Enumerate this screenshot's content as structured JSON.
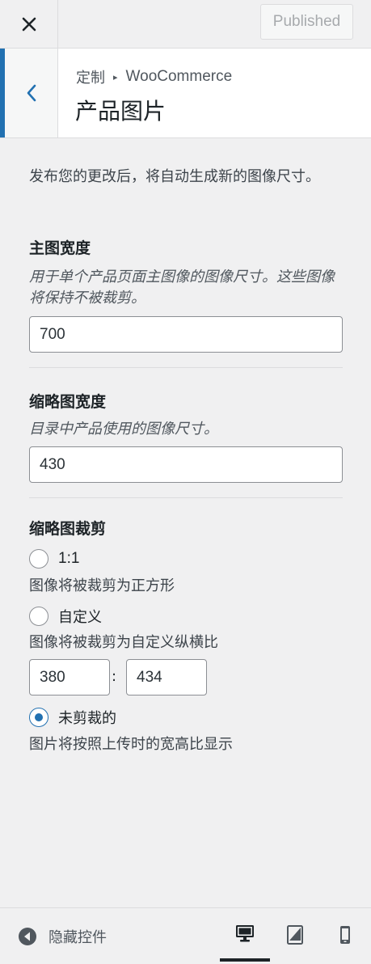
{
  "topbar": {
    "close_icon": "close-icon",
    "publish_label": "Published"
  },
  "header": {
    "back_icon": "chevron-left-icon",
    "breadcrumb_root": "定制",
    "breadcrumb_sep": "▸",
    "breadcrumb_section": "WooCommerce",
    "title": "产品图片"
  },
  "intro": "发布您的更改后，将自动生成新的图像尺寸。",
  "main_width": {
    "title": "主图宽度",
    "description": "用于单个产品页面主图像的图像尺寸。这些图像将保持不被裁剪。",
    "value": "700"
  },
  "thumb_width": {
    "title": "缩略图宽度",
    "description": "目录中产品使用的图像尺寸。",
    "value": "430"
  },
  "thumb_crop": {
    "title": "缩略图裁剪",
    "options": [
      {
        "label": "1:1",
        "description": "图像将被裁剪为正方形",
        "checked": false
      },
      {
        "label": "自定义",
        "description": "图像将被裁剪为自定义纵横比",
        "checked": false
      },
      {
        "label": "未剪裁的",
        "description": "图片将按照上传时的宽高比显示",
        "checked": true
      }
    ],
    "custom_width": "380",
    "custom_sep": ":",
    "custom_height": "434"
  },
  "footer": {
    "hide_label": "隐藏控件",
    "hide_icon": "collapse-arrow-icon",
    "devices": [
      "desktop-icon",
      "tablet-icon",
      "mobile-icon"
    ],
    "active_device": "desktop"
  },
  "colors": {
    "accent": "#2271b1",
    "text": "#1d2327",
    "muted": "#50575e",
    "background": "#f0f0f1"
  }
}
